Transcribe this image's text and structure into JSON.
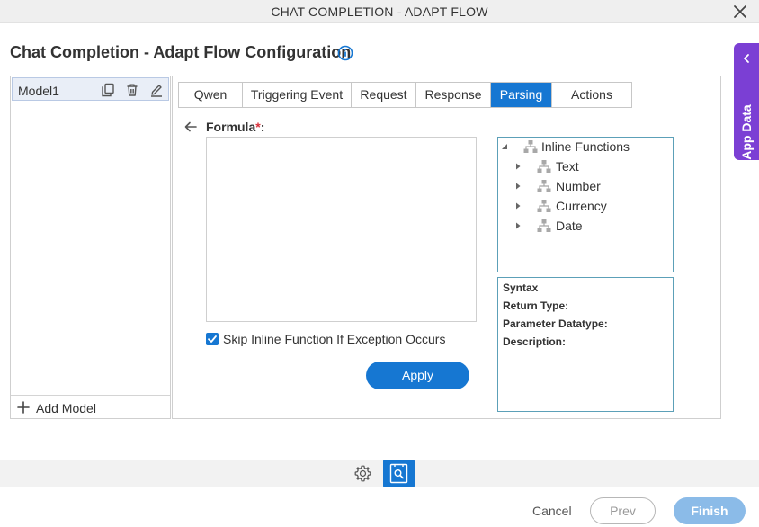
{
  "window": {
    "title": "CHAT COMPLETION - ADAPT FLOW"
  },
  "page": {
    "title": "Chat Completion - Adapt Flow Configuration"
  },
  "app_data_tab": {
    "label": "App Data"
  },
  "models": {
    "items": [
      {
        "label": "Model1"
      }
    ],
    "add_label": "Add Model"
  },
  "tabs": [
    {
      "label": "Qwen",
      "active": false
    },
    {
      "label": "Triggering Event",
      "active": false
    },
    {
      "label": "Request",
      "active": false
    },
    {
      "label": "Response",
      "active": false
    },
    {
      "label": "Parsing",
      "active": true
    },
    {
      "label": "Actions",
      "active": false
    }
  ],
  "formula": {
    "label": "Formula",
    "required_mark": "*",
    "suffix": ":",
    "value": ""
  },
  "skip_option": {
    "label": "Skip Inline Function If Exception Occurs",
    "checked": true
  },
  "apply_label": "Apply",
  "function_tree": {
    "root": {
      "label": "Inline Functions",
      "expanded": true
    },
    "children": [
      {
        "label": "Text"
      },
      {
        "label": "Number"
      },
      {
        "label": "Currency"
      },
      {
        "label": "Date"
      }
    ]
  },
  "syntax_panel": {
    "syntax": "Syntax",
    "return_type": "Return Type:",
    "parameter_datatype": "Parameter Datatype:",
    "description": "Description:"
  },
  "footer": {
    "cancel_label": "Cancel",
    "prev_label": "Prev",
    "finish_label": "Finish"
  },
  "colors": {
    "accent": "#1677d2",
    "app_data": "#7b3fd4",
    "required": "#d9303a",
    "finish_disabled": "#8bbbe8"
  }
}
